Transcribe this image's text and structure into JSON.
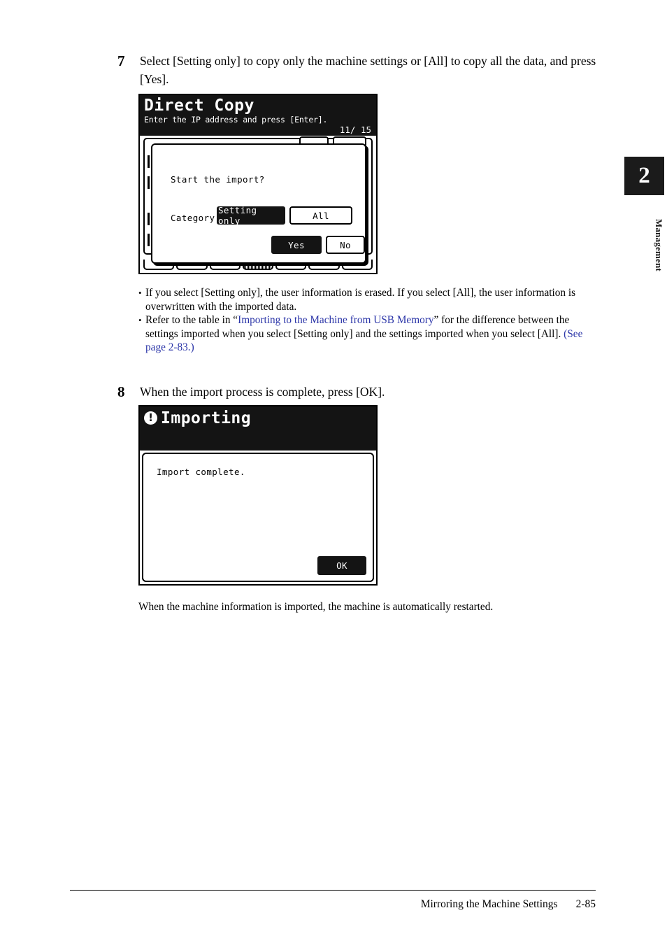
{
  "page": {
    "side_tab_number": "2",
    "side_tab_label": "Management",
    "footer_section": "Mirroring the Machine Settings",
    "footer_page": "2-85"
  },
  "steps": [
    {
      "number": "7",
      "text": "Select [Setting only] to copy only the machine settings or [All] to copy all the data, and press [Yes]."
    },
    {
      "number": "8",
      "text": "When the import process is complete, press [OK]."
    }
  ],
  "notes": [
    {
      "bullet": "•",
      "text": "If you select [Setting only], the user information is erased. If you select [All], the user information is overwritten with the imported data."
    },
    {
      "bullet": "•",
      "lead": "Refer to the table in “",
      "link1": "Importing to the Machine from USB Memory",
      "mid": "” for the difference between the settings imported when you select [Setting only] and the settings imported when you select [All]. ",
      "link2": "(See page 2-83.)"
    }
  ],
  "closing_paragraph": "When the machine information is imported, the machine is automatically restarted.",
  "screen1": {
    "title": "Direct Copy",
    "subtitle": "Enter the IP address and press [Enter].",
    "counter": "11/ 15",
    "dialog": {
      "question": "Start the import?",
      "category_label": "Category:",
      "buttons": {
        "setting_only": "Setting only",
        "all": "All",
        "yes": "Yes",
        "no": "No"
      },
      "selected_category": "Setting only",
      "selected_confirm": "Yes"
    }
  },
  "screen2": {
    "icon": "warning-exclamation-icon",
    "icon_glyph": "!",
    "title": "Importing",
    "message": "Import complete.",
    "ok_label": "OK"
  },
  "colors": {
    "lcd_header_bg": "#141414",
    "lcd_bg": "#ffffff",
    "link": "#2b35a8",
    "side_tab_bg": "#1b1b1b"
  }
}
